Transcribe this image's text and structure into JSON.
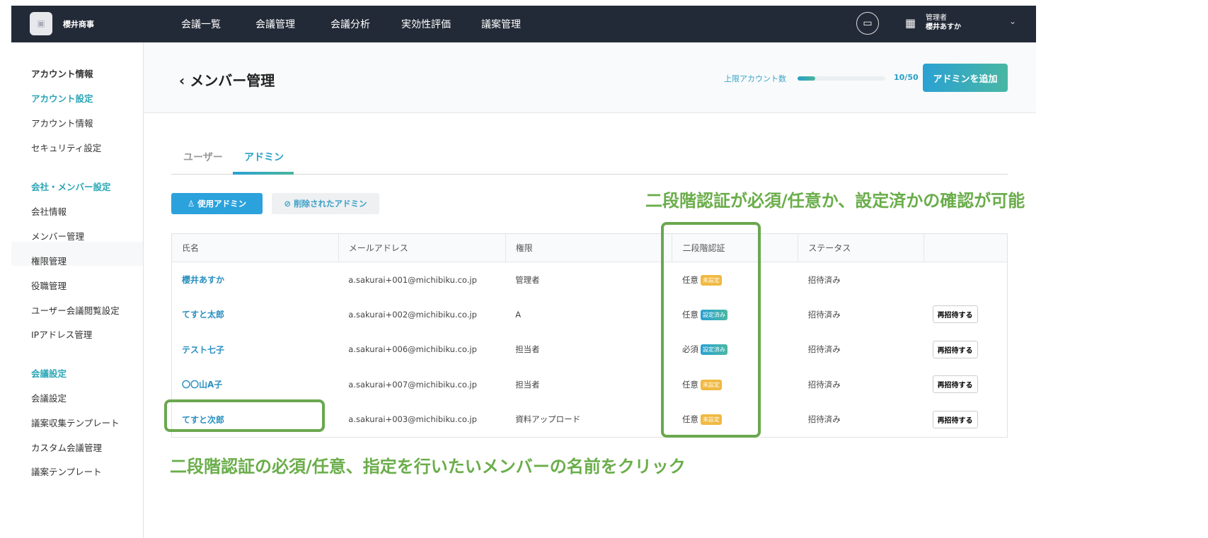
{
  "topbar": {
    "company": "櫻井商事",
    "nav": [
      "会議一覧",
      "会議管理",
      "会議分析",
      "実効性評価",
      "議案管理"
    ],
    "user_role": "管理者",
    "user_name": "櫻井あすか"
  },
  "sidebar": {
    "items": [
      {
        "label": "アカウント情報",
        "type": "h"
      },
      {
        "label": "アカウント設定",
        "type": "sec"
      },
      {
        "label": "アカウント情報"
      },
      {
        "label": "セキュリティ設定"
      },
      {
        "label": "会社・メンバー設定",
        "type": "sec"
      },
      {
        "label": "会社情報"
      },
      {
        "label": "メンバー管理"
      },
      {
        "label": "権限管理"
      },
      {
        "label": "役職管理"
      },
      {
        "label": "ユーザー会議閲覧設定"
      },
      {
        "label": "IPアドレス管理"
      },
      {
        "label": "会議設定",
        "type": "sec"
      },
      {
        "label": "会議設定"
      },
      {
        "label": "議案収集テンプレート"
      },
      {
        "label": "カスタム会議管理"
      },
      {
        "label": "議案テンプレート"
      }
    ]
  },
  "header": {
    "title": "メンバー管理",
    "limit_label": "上限アカウント数",
    "limit_used": 10,
    "limit_max": 50,
    "limit_text": "10/50",
    "add_button": "アドミンを追加"
  },
  "tabs": [
    "ユーザー",
    "アドミン"
  ],
  "filters": {
    "active": "使用アドミン",
    "deleted": "削除されたアドミン"
  },
  "table": {
    "headers": [
      "氏名",
      "メールアドレス",
      "権限",
      "二段階認証",
      "ステータス",
      ""
    ],
    "rows": [
      {
        "name": "櫻井あすか",
        "email": "a.sakurai+001@michibiku.co.jp",
        "role": "管理者",
        "twofa": "任意",
        "twofa_status": "未設定",
        "status": "招待済み",
        "action": ""
      },
      {
        "name": "てすと太郎",
        "email": "a.sakurai+002@michibiku.co.jp",
        "role": "A",
        "twofa": "任意",
        "twofa_status": "設定済み",
        "status": "招待済み",
        "action": "再招待する"
      },
      {
        "name": "テスト七子",
        "email": "a.sakurai+006@michibiku.co.jp",
        "role": "担当者",
        "twofa": "必須",
        "twofa_status": "設定済み",
        "status": "招待済み",
        "action": "再招待する"
      },
      {
        "name": "〇〇山A子",
        "email": "a.sakurai+007@michibiku.co.jp",
        "role": "担当者",
        "twofa": "任意",
        "twofa_status": "未設定",
        "status": "招待済み",
        "action": "再招待する"
      },
      {
        "name": "てすと次郎",
        "email": "a.sakurai+003@michibiku.co.jp",
        "role": "資料アップロード",
        "twofa": "任意",
        "twofa_status": "未設定",
        "status": "招待済み",
        "action": "再招待する"
      }
    ]
  },
  "annotations": {
    "top": "二段階認証が必須/任意か、設定済かの確認が可能",
    "bottom": "二段階認証の必須/任意、指定を行いたいメンバーの名前をクリック"
  },
  "colors": {
    "topbar": "#232a37",
    "accent": "#2aa1c7",
    "annotation": "#6aa84f",
    "badge_unset": "#f0b942"
  }
}
